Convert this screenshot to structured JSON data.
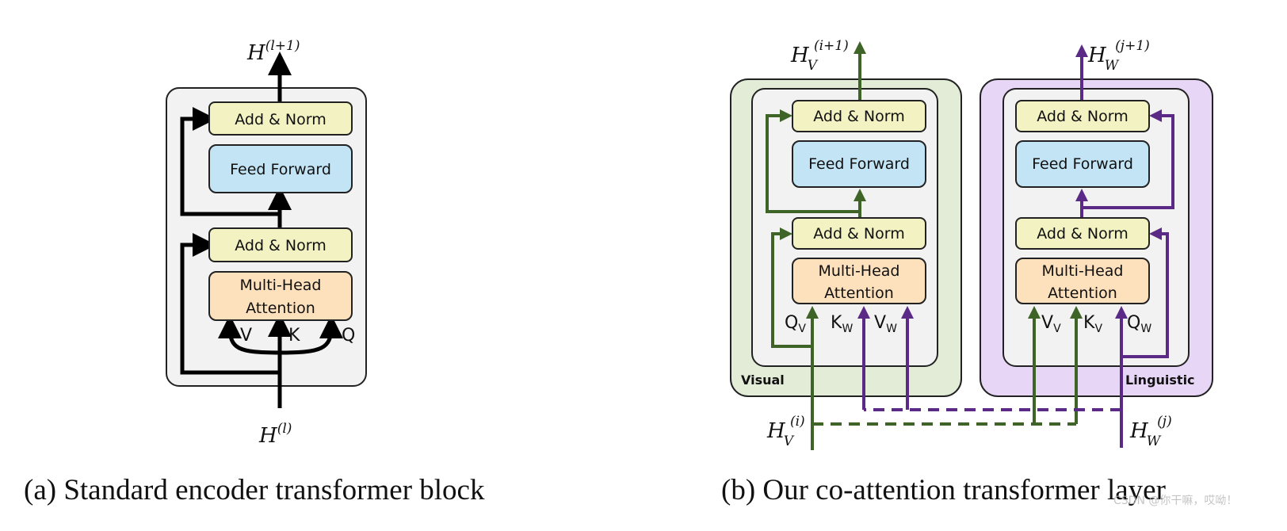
{
  "panel_a": {
    "output_label": {
      "base": "H",
      "sup": "(l+1)"
    },
    "input_label": {
      "base": "H",
      "sup": "(l)"
    },
    "blocks": {
      "add_norm_top": "Add & Norm",
      "feed_forward": "Feed Forward",
      "add_norm_bottom": "Add & Norm",
      "mha_line1": "Multi-Head",
      "mha_line2": "Attention"
    },
    "inputs": {
      "v": "V",
      "k": "K",
      "q": "Q"
    },
    "caption": "(a) Standard encoder transformer block"
  },
  "panel_b": {
    "visual": {
      "stream_label": "Visual",
      "output_label": {
        "base": "H",
        "sub": "V",
        "sup": "(i+1)"
      },
      "input_label": {
        "base": "H",
        "sub": "V",
        "sup": "(i)"
      },
      "blocks": {
        "add_norm_top": "Add & Norm",
        "feed_forward": "Feed Forward",
        "add_norm_bottom": "Add & Norm",
        "mha_line1": "Multi-Head",
        "mha_line2": "Attention"
      },
      "inputs": [
        {
          "base": "Q",
          "sub": "V"
        },
        {
          "base": "K",
          "sub": "W"
        },
        {
          "base": "V",
          "sub": "W"
        }
      ]
    },
    "linguistic": {
      "stream_label": "Linguistic",
      "output_label": {
        "base": "H",
        "sub": "W",
        "sup": "(j+1)"
      },
      "input_label": {
        "base": "H",
        "sub": "W",
        "sup": "(j)"
      },
      "blocks": {
        "add_norm_top": "Add & Norm",
        "feed_forward": "Feed Forward",
        "add_norm_bottom": "Add & Norm",
        "mha_line1": "Multi-Head",
        "mha_line2": "Attention"
      },
      "inputs": [
        {
          "base": "V",
          "sub": "V"
        },
        {
          "base": "K",
          "sub": "V"
        },
        {
          "base": "Q",
          "sub": "W"
        }
      ]
    },
    "caption": "(b) Our co-attention transformer layer"
  },
  "watermark": "CSDN @你干嘛，哎呦！",
  "colors": {
    "visual_stream": "#3e6428",
    "linguistic_stream": "#5a2a86",
    "visual_bg": "#e2ecd6",
    "linguistic_bg": "#e7d6f6",
    "add_norm": "#f2f2c2",
    "feed_forward": "#c2e4f4",
    "attention": "#fde0bc"
  }
}
